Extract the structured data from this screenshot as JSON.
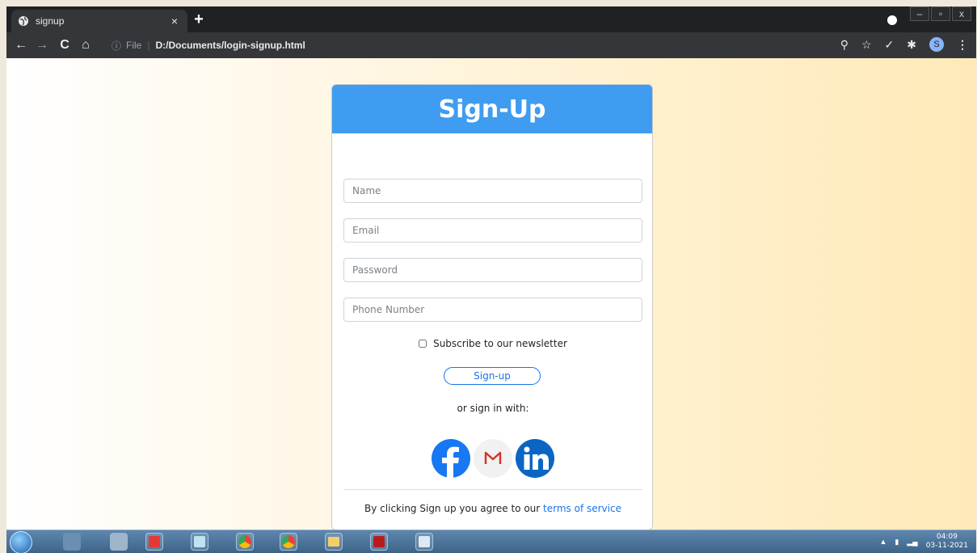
{
  "browser": {
    "tab_title": "signup",
    "tab_close": "×",
    "new_tab": "+",
    "url_scheme": "File",
    "url": "D:/Documents/login-signup.html",
    "profile_initial": "S"
  },
  "window_controls": {
    "minimize": "–",
    "restore": "▫",
    "close": "x"
  },
  "card": {
    "title": "Sign-Up",
    "fields": {
      "name_placeholder": "Name",
      "email_placeholder": "Email",
      "password_placeholder": "Password",
      "phone_placeholder": "Phone Number"
    },
    "newsletter_label": "Subscribe to our newsletter",
    "signup_button": "Sign-up",
    "or_text": "or sign in with:",
    "social": [
      "facebook-icon",
      "gmail-icon",
      "linkedin-icon"
    ],
    "terms_prefix": "By clicking Sign up you agree to our ",
    "terms_link": "terms of service"
  },
  "taskbar": {
    "time": "04:09",
    "date": "03-11-2021"
  },
  "colors": {
    "header_blue": "#3f9cf0",
    "link_blue": "#1a73e8"
  }
}
